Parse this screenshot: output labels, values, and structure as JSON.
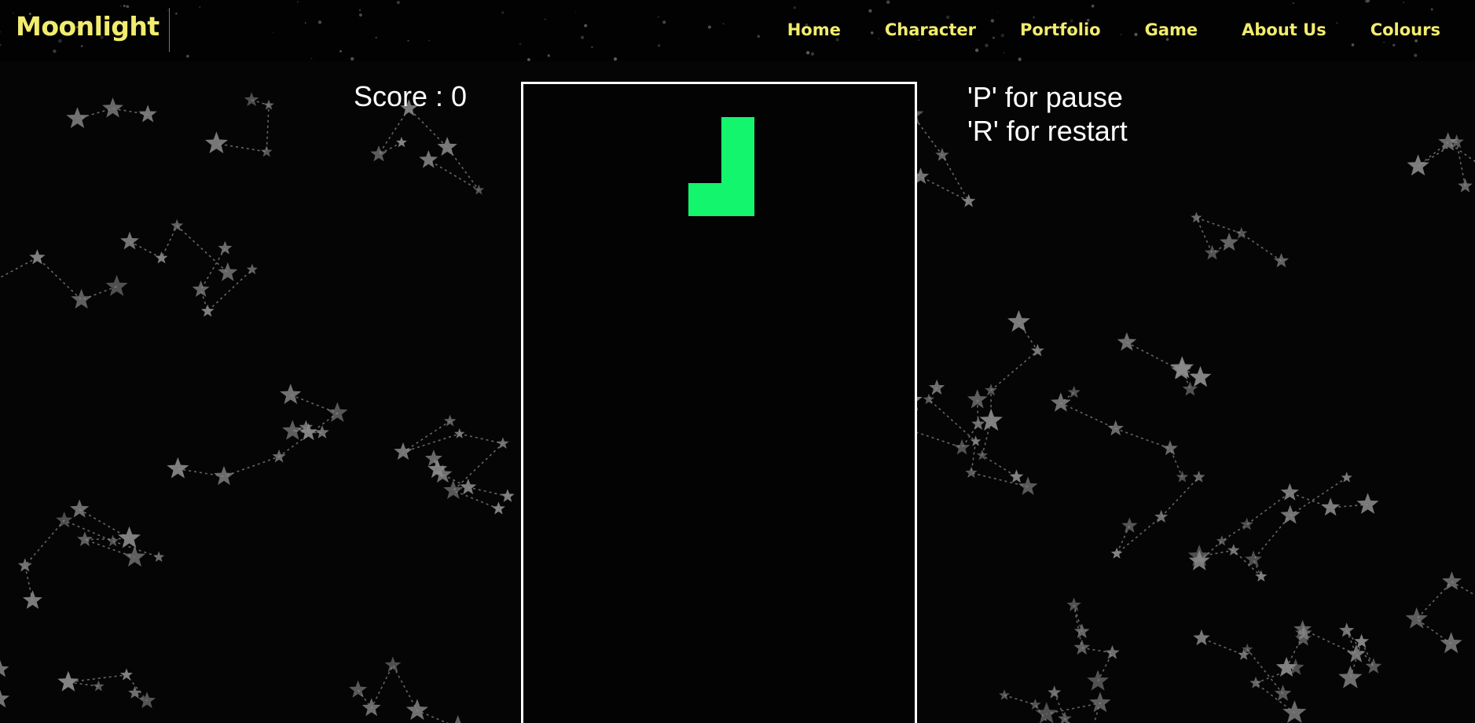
{
  "navbar": {
    "logo": "Moonlight",
    "links": [
      "Home",
      "Character",
      "Portfolio",
      "Game",
      "About Us",
      "Colours"
    ]
  },
  "game": {
    "score_label": "Score : 0",
    "instructions": [
      "'P' for pause",
      "'R' for restart"
    ],
    "board": {
      "columns": 12,
      "rows": 20
    },
    "current_piece": {
      "type": "J",
      "color": "#13f56d",
      "cells": [
        [
          6,
          1
        ],
        [
          6,
          2
        ],
        [
          6,
          3
        ],
        [
          5,
          3
        ]
      ]
    }
  },
  "colors": {
    "accent": "#f2ec6e",
    "background": "#000000",
    "board_border": "#ffffff",
    "piece": "#13f56d"
  }
}
